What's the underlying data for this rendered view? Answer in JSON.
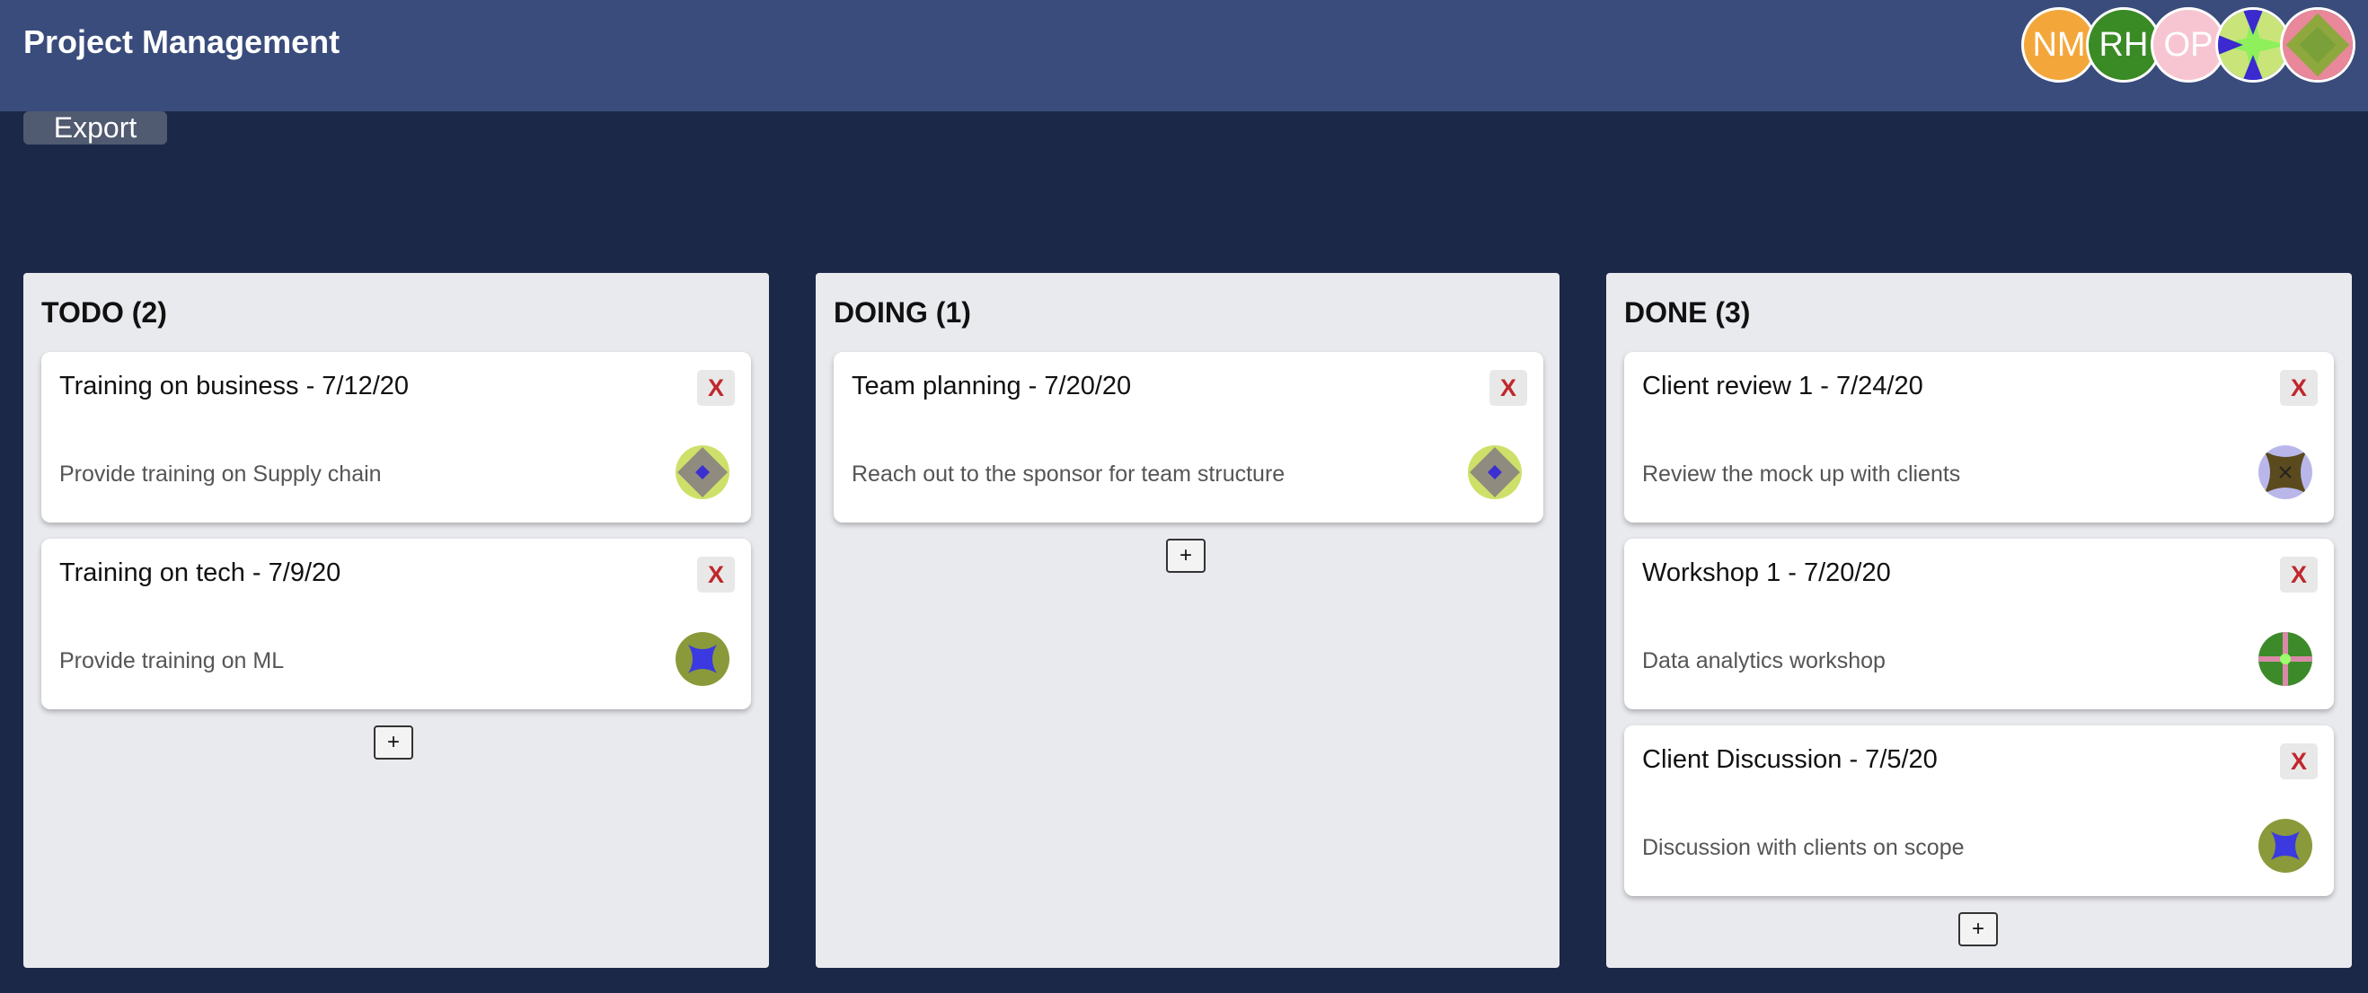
{
  "app": {
    "title": "Project Management"
  },
  "toolbar": {
    "export_label": "Export"
  },
  "header_avatars": [
    {
      "initials": "NM",
      "color": "#f3a73b"
    },
    {
      "initials": "RH",
      "color": "#3a8a26"
    },
    {
      "initials": "OP",
      "color": "#f7c5d2"
    },
    {
      "initials": "",
      "icon": "geometric-avatar-icon",
      "color": "#c9e57a"
    },
    {
      "initials": "",
      "icon": "geometric-avatar-icon",
      "color": "#e9879b"
    }
  ],
  "columns": [
    {
      "title": "TODO (2)",
      "add_label": "+",
      "cards": [
        {
          "title": "Training on business - 7/12/20",
          "description": "Provide training on Supply chain",
          "delete_label": "X",
          "assignee_icon": "geometric-avatar-icon"
        },
        {
          "title": "Training on tech - 7/9/20",
          "description": "Provide training on ML",
          "delete_label": "X",
          "assignee_icon": "geometric-avatar-icon"
        }
      ]
    },
    {
      "title": "DOING (1)",
      "add_label": "+",
      "cards": [
        {
          "title": "Team planning - 7/20/20",
          "description": "Reach out to the sponsor for team structure",
          "delete_label": "X",
          "assignee_icon": "geometric-avatar-icon"
        }
      ]
    },
    {
      "title": "DONE (3)",
      "add_label": "+",
      "cards": [
        {
          "title": "Client review 1 - 7/24/20",
          "description": "Review the mock up with clients",
          "delete_label": "X",
          "assignee_icon": "geometric-avatar-icon"
        },
        {
          "title": "Workshop 1 - 7/20/20",
          "description": "Data analytics workshop",
          "delete_label": "X",
          "assignee_icon": "geometric-avatar-icon"
        },
        {
          "title": "Client Discussion - 7/5/20",
          "description": "Discussion with clients on scope",
          "delete_label": "X",
          "assignee_icon": "geometric-avatar-icon"
        }
      ]
    }
  ]
}
